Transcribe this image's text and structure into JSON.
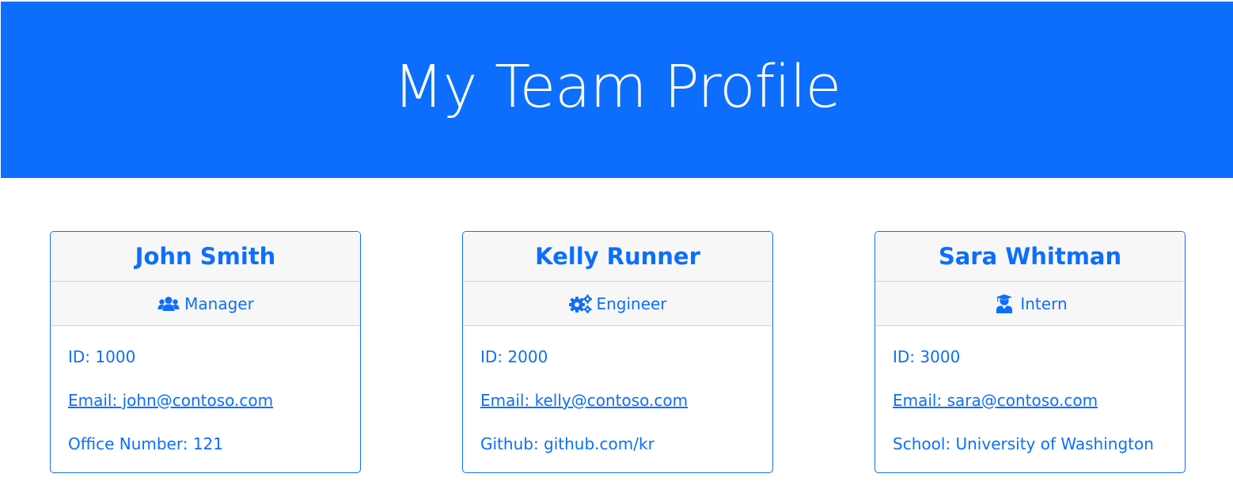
{
  "header": {
    "title": "My Team Profile"
  },
  "colors": {
    "accent": "#0d6efd",
    "card_header_bg": "#f7f7f7"
  },
  "team": [
    {
      "name": "John Smith",
      "role": "Manager",
      "role_icon": "users-icon",
      "id_text": "ID: 1000",
      "email_text": "Email: john@contoso.com",
      "extra_text": "Office Number: 121"
    },
    {
      "name": "Kelly Runner",
      "role": "Engineer",
      "role_icon": "gears-icon",
      "id_text": "ID: 2000",
      "email_text": "Email: kelly@contoso.com",
      "extra_text": "Github: github.com/kr"
    },
    {
      "name": "Sara Whitman",
      "role": "Intern",
      "role_icon": "graduate-icon",
      "id_text": "ID: 3000",
      "email_text": "Email: sara@contoso.com",
      "extra_text": "School: University of Washington"
    }
  ]
}
